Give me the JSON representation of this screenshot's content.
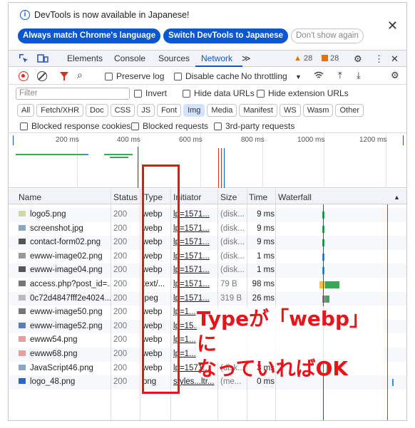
{
  "banner": {
    "message": "DevTools is now available in Japanese!",
    "btn_match": "Always match Chrome's language",
    "btn_switch": "Switch DevTools to Japanese",
    "btn_dont": "Don't show again",
    "close": "✕"
  },
  "tabs": {
    "elements": "Elements",
    "console": "Console",
    "sources": "Sources",
    "network": "Network",
    "more": "≫",
    "warnings": "28",
    "issues": "28"
  },
  "toolbar": {
    "preserve_log": "Preserve log",
    "disable_cache": "Disable cache",
    "throttling": "No throttling"
  },
  "filter": {
    "placeholder": "Filter",
    "invert": "Invert",
    "hide_data_urls": "Hide data URLs",
    "hide_ext_urls": "Hide extension URLs"
  },
  "chips": [
    "All",
    "Fetch/XHR",
    "Doc",
    "CSS",
    "JS",
    "Font",
    "Img",
    "Media",
    "Manifest",
    "WS",
    "Wasm",
    "Other"
  ],
  "active_chip": "Img",
  "blocked": {
    "cookies": "Blocked response cookies",
    "requests": "Blocked requests",
    "third_party": "3rd-party requests"
  },
  "overview_ticks": [
    "200 ms",
    "400 ms",
    "600 ms",
    "800 ms",
    "1000 ms",
    "1200 ms"
  ],
  "columns": {
    "name": "Name",
    "status": "Status",
    "type": "Type",
    "initiator": "Initiator",
    "size": "Size",
    "time": "Time",
    "waterfall": "Waterfall"
  },
  "rows": [
    {
      "name": "logo5.png",
      "status": "200",
      "type": "webp",
      "initiator": "lp=1571...",
      "size": "(disk...",
      "time": "9 ms"
    },
    {
      "name": "screenshot.jpg",
      "status": "200",
      "type": "webp",
      "initiator": "lp=1571...",
      "size": "(disk...",
      "time": "9 ms"
    },
    {
      "name": "contact-form02.png",
      "status": "200",
      "type": "webp",
      "initiator": "lp=1571...",
      "size": "(disk...",
      "time": "9 ms"
    },
    {
      "name": "ewww-image02.png",
      "status": "200",
      "type": "webp",
      "initiator": "lp=1571...",
      "size": "(disk...",
      "time": "1 ms"
    },
    {
      "name": "ewww-image04.png",
      "status": "200",
      "type": "webp",
      "initiator": "lp=1571...",
      "size": "(disk...",
      "time": "1 ms"
    },
    {
      "name": "access.php?post_id=...",
      "status": "200",
      "type": "text/...",
      "initiator": "lp=1571...",
      "size": "79 B",
      "time": "98 ms"
    },
    {
      "name": "0c72d4847fff2e4024...",
      "status": "200",
      "type": "jpeg",
      "initiator": "lp=1571...",
      "size": "319 B",
      "time": "26 ms"
    },
    {
      "name": "ewww-image50.png",
      "status": "200",
      "type": "webp",
      "initiator": "lp=1...",
      "size": "",
      "time": ""
    },
    {
      "name": "ewww-image52.png",
      "status": "200",
      "type": "webp",
      "initiator": "lp=15...",
      "size": "",
      "time": ""
    },
    {
      "name": "ewww54.png",
      "status": "200",
      "type": "webp",
      "initiator": "lp=1...",
      "size": "",
      "time": ""
    },
    {
      "name": "ewww68.png",
      "status": "200",
      "type": "webp",
      "initiator": "lp=1...",
      "size": "",
      "time": ""
    },
    {
      "name": "JavaScript46.png",
      "status": "200",
      "type": "webp",
      "initiator": "lp=1571...",
      "size": "(disk...",
      "time": "3 ms"
    },
    {
      "name": "logo_48.png",
      "status": "200",
      "type": "png",
      "initiator": "styles...ltr...",
      "size": "(me...",
      "time": "0 ms"
    }
  ],
  "annotation": {
    "line1": "Typeが「webp」に",
    "line2": "なっていればOK",
    "color": "#e8141a"
  }
}
